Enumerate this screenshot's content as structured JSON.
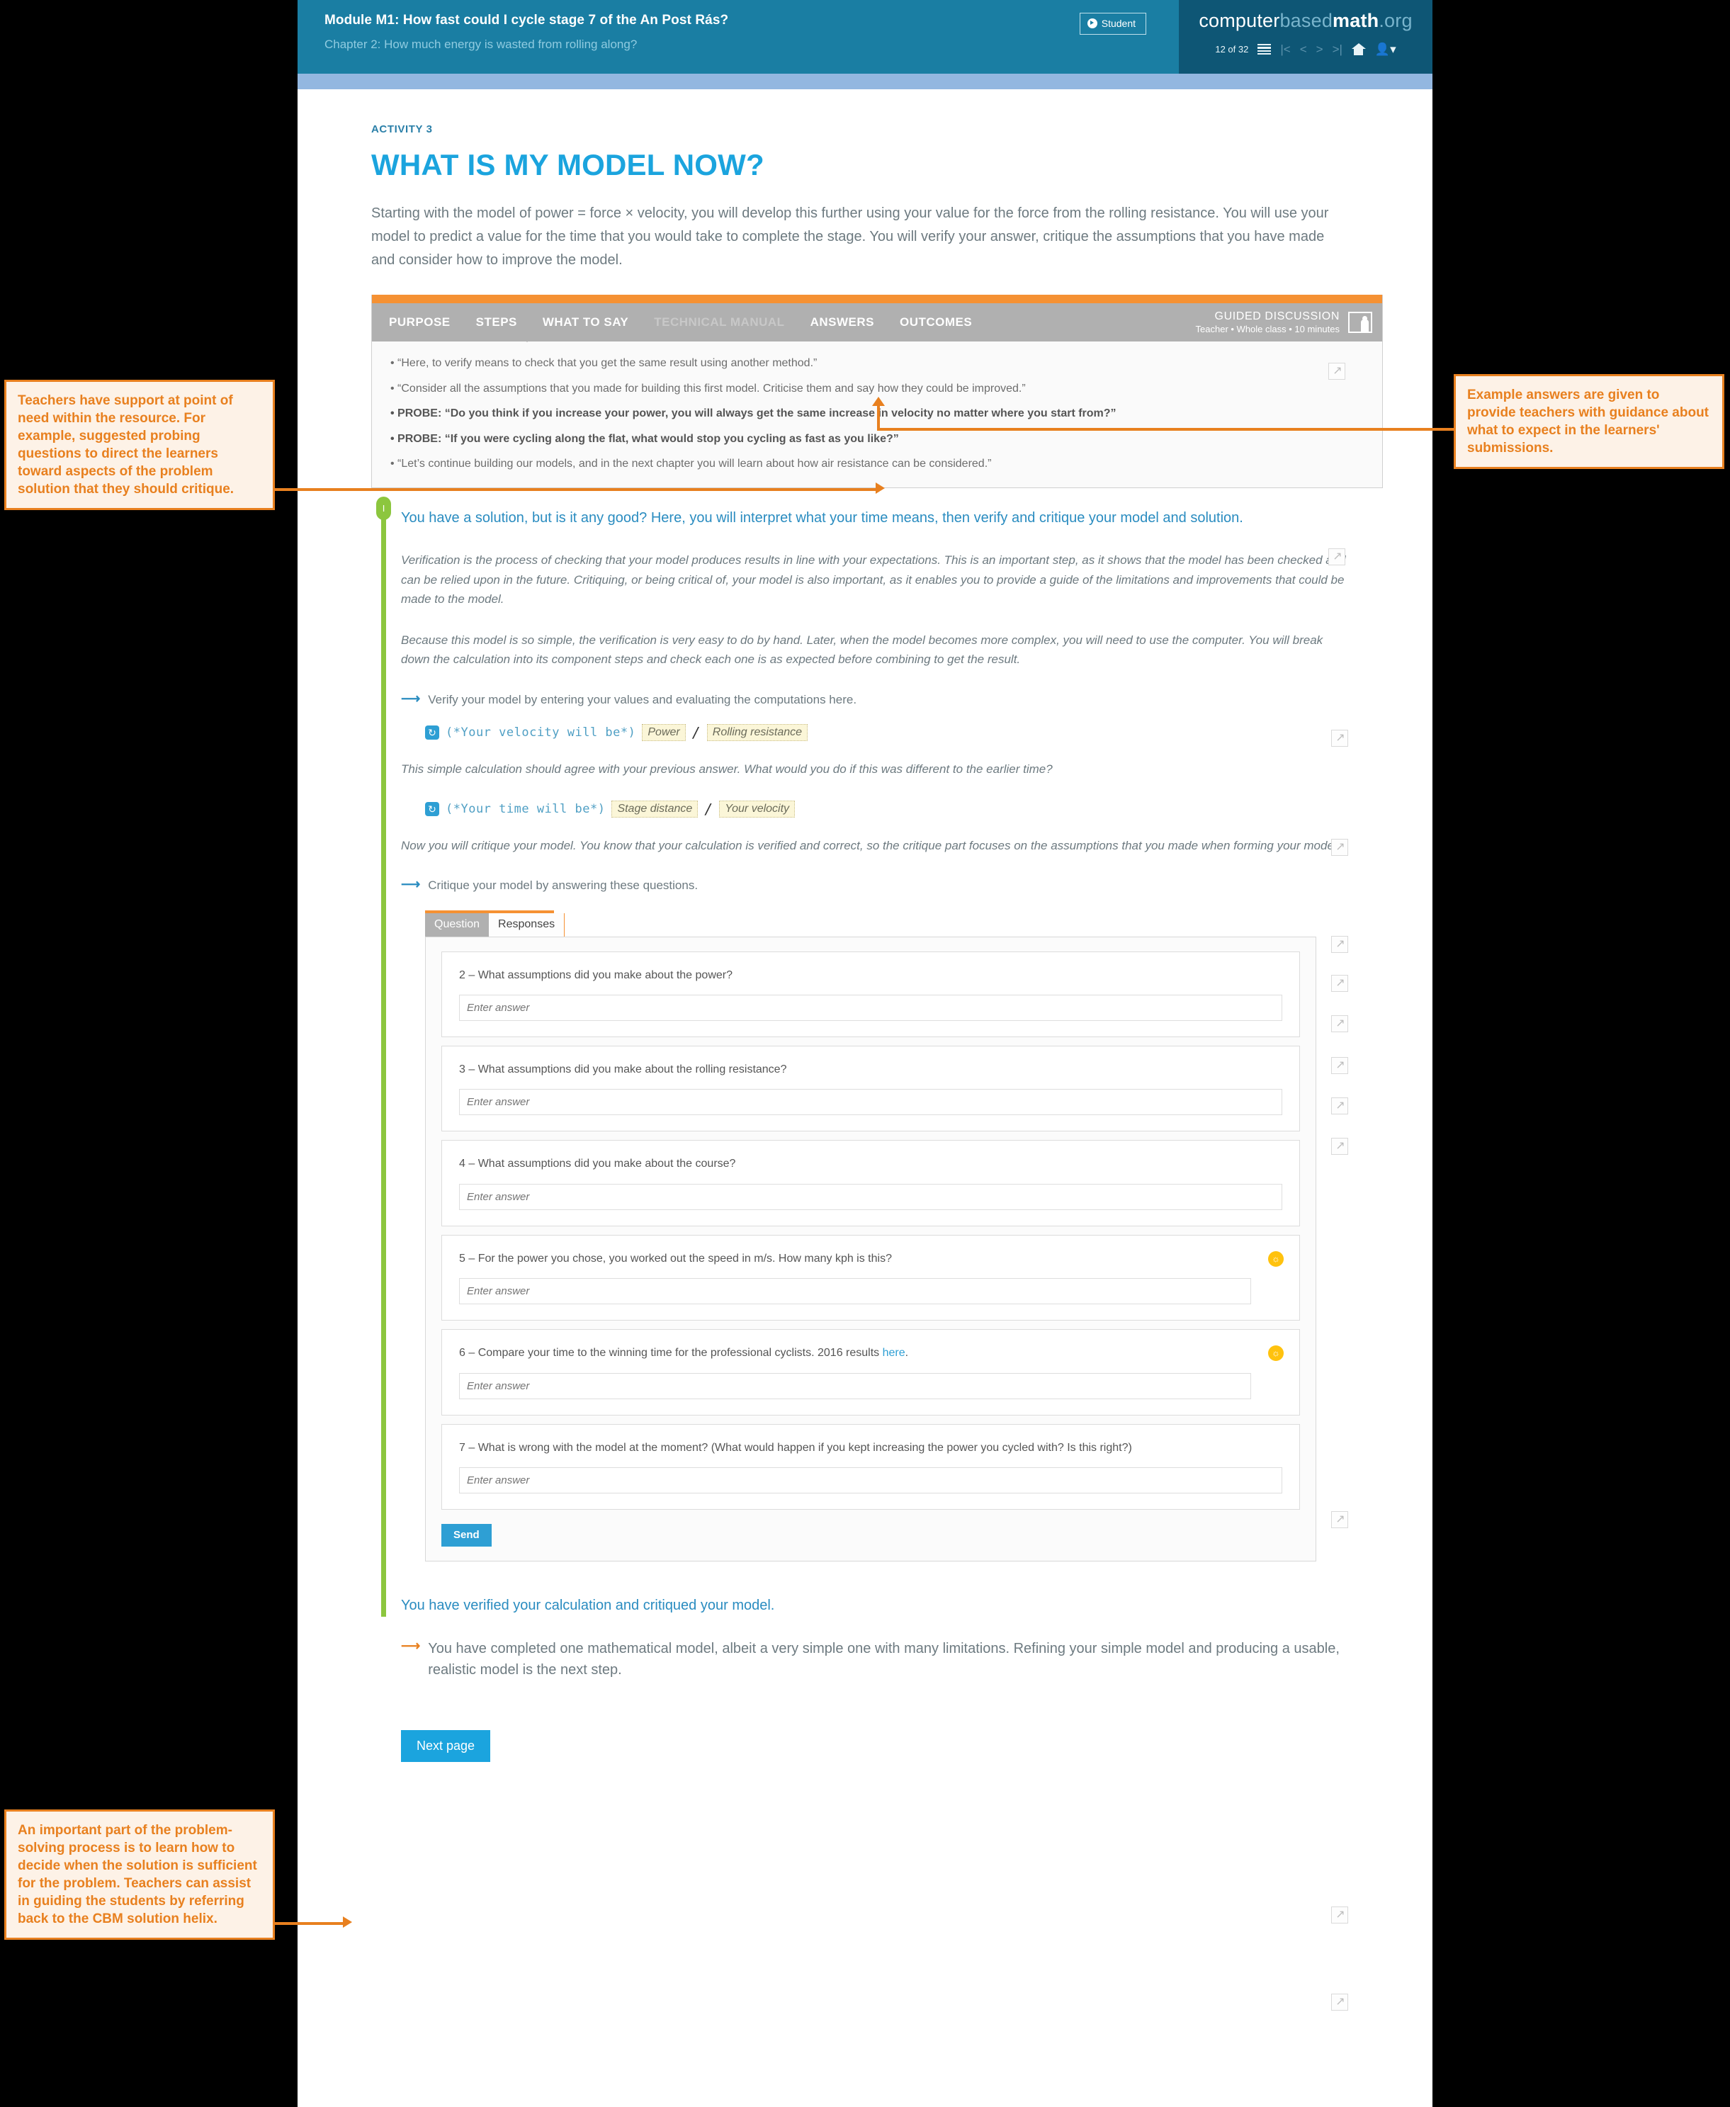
{
  "header": {
    "module_title": "Module M1: How fast could I cycle stage 7 of the An Post Rás?",
    "chapter_title": "Chapter 2: How much energy is wasted from rolling along?",
    "student_badge": "Student",
    "brand": {
      "part1": "computer",
      "part2": "based",
      "part3": "math",
      "part4": ".org"
    },
    "page_count": "12 of 32"
  },
  "activity": {
    "kicker": "ACTIVITY 3",
    "title": "WHAT IS MY MODEL NOW?",
    "intro": "Starting with the model of power = force × velocity, you will develop this further using your value for the force from the rolling resistance. You will use your model to predict a value for the time that you would take to complete the stage. You will verify your answer, critique the assumptions that you have made and consider how to improve the model."
  },
  "teacher_panel": {
    "tabs": [
      {
        "label": "PURPOSE",
        "state": "normal"
      },
      {
        "label": "STEPS",
        "state": "normal"
      },
      {
        "label": "WHAT TO SAY",
        "state": "normal"
      },
      {
        "label": "TECHNICAL MANUAL",
        "state": "dim"
      },
      {
        "label": "ANSWERS",
        "state": "normal"
      },
      {
        "label": "OUTCOMES",
        "state": "normal"
      }
    ],
    "badge_title": "GUIDED DISCUSSION",
    "badge_meta": "Teacher • Whole class • 10 minutes",
    "lines": [
      {
        "text": "• “Here, to verify means to check that you get the same result using another method.”",
        "bold": false
      },
      {
        "text": "• “Consider all the assumptions that you made for building this first model. Criticise them and say how they could be improved.”",
        "bold": false
      },
      {
        "text": "• PROBE: “Do you think if you increase your power, you will always get the same increase in velocity no matter where you start from?”",
        "bold": true
      },
      {
        "text": "• PROBE: “If you were cycling along the flat, what would stop you cycling as fast as you like?”",
        "bold": true
      },
      {
        "text": "• “Let’s continue building our models, and in the next chapter you will learn about how air resistance can be considered.”",
        "bold": false
      }
    ]
  },
  "main": {
    "knob_label": "I",
    "heading": "You have a solution, but is it any good? Here, you will interpret what your time means, then verify and critique your model and solution.",
    "para1": "Verification is the process of checking that your model produces results in line with your expectations. This is an important step, as it shows that the model has been checked and can be relied upon in the future. Critiquing, or being critical of, your model is also important, as it enables you to provide a guide of the limitations and improvements that could be made to the model.",
    "para2": "Because this model is so simple, the verification is very easy to do by hand. Later, when the model becomes more complex, you will need to use the computer. You will break down the calculation into its component steps and check each one is as expected before combining to get the result.",
    "instruction1": "Verify your model by entering your values and evaluating the computations here.",
    "formula1": {
      "code": "(*Your velocity will be*)",
      "slot1": "Power",
      "divider": "/",
      "slot2": "Rolling resistance"
    },
    "para3": "This simple calculation should agree with your previous answer. What would you do if this was different to the earlier time?",
    "formula2": {
      "code": "(*Your time will be*)",
      "slot1": "Stage distance",
      "divider": "/",
      "slot2": "Your velocity"
    },
    "para4": "Now you will critique your model. You know that your calculation is verified and correct, so the critique part focuses on the assumptions that you made when forming your model.",
    "instruction2": "Critique your model by answering these questions."
  },
  "question_widget": {
    "tab_question": "Question",
    "tab_responses": "Responses",
    "input_placeholder": "Enter answer",
    "send_label": "Send",
    "questions": [
      {
        "number": "2",
        "text": "2  –  What assumptions did you make about the power?",
        "hint": false
      },
      {
        "number": "3",
        "text": "3  –  What assumptions did you make about the rolling resistance?",
        "hint": false
      },
      {
        "number": "4",
        "text": "4  –  What assumptions did you make about the course?",
        "hint": false
      },
      {
        "number": "5",
        "text": "5  –  For the power you chose, you worked out the speed in m/s. How many kph is this?",
        "hint": true
      },
      {
        "number": "6",
        "text": "6  –  Compare your time to the winning time for the professional cyclists. 2016 results ",
        "link": "here",
        "text_after": ".",
        "hint": true
      },
      {
        "number": "7",
        "text": "7  –  What is wrong with the model at the moment? (What would happen if you kept increasing the power you cycled with? Is this right?)",
        "hint": false
      }
    ]
  },
  "footer": {
    "heading": "You have verified your calculation and critiqued your model.",
    "closing": "You have completed one mathematical model, albeit a very simple one with many limitations. Refining your simple model and producing a usable, realistic model is the next step.",
    "next_page": "Next page"
  },
  "annotations": {
    "left_top": "Teachers have support at point of need within the resource. For example, suggested probing questions to direct the learners toward aspects of the problem solution that they should critique.",
    "right_top": "Example answers are given to provide teachers with guidance about what to expect in the learners' submissions.",
    "left_bottom": "An important part of the problem-solving process is to learn how to decide when the solution is sufficient for the problem. Teachers can assist in guiding the students by referring back to the CBM solution helix."
  },
  "colors": {
    "accent_blue": "#1ba4de",
    "header_blue": "#1a7ea3",
    "header_dark": "#0e5675",
    "orange": "#e8801f",
    "green": "#8cc63e"
  }
}
